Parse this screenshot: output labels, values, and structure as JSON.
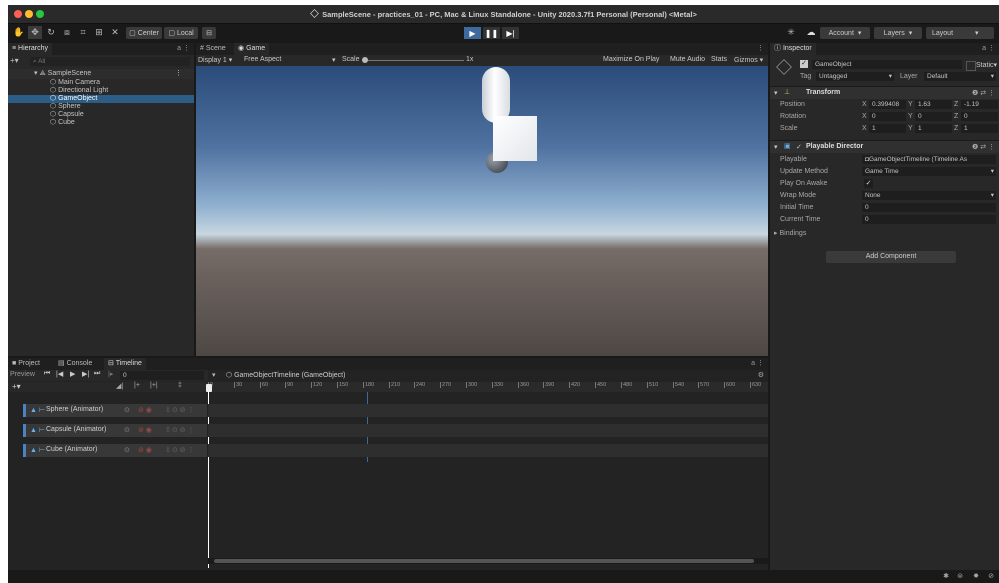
{
  "window": {
    "title": "SampleScene - practices_01 - PC, Mac & Linux Standalone - Unity 2020.3.7f1 Personal (Personal) <Metal>"
  },
  "toolbar": {
    "center_label": "Center",
    "local_label": "Local",
    "account_label": "Account",
    "layers_label": "Layers",
    "layout_label": "Layout"
  },
  "hierarchy": {
    "tab_label": "Hierarchy",
    "search_placeholder": "All",
    "scene": "SampleScene",
    "items": [
      {
        "label": "Main Camera",
        "selected": false
      },
      {
        "label": "Directional Light",
        "selected": false
      },
      {
        "label": "GameObject",
        "selected": true
      },
      {
        "label": "Sphere",
        "selected": false
      },
      {
        "label": "Capsule",
        "selected": false
      },
      {
        "label": "Cube",
        "selected": false
      }
    ]
  },
  "center": {
    "tabs": [
      {
        "label": "Scene"
      },
      {
        "label": "Game"
      }
    ],
    "display": "Display 1",
    "aspect": "Free Aspect",
    "scale_label": "Scale",
    "scale_value": "1x",
    "maximize": "Maximize On Play",
    "mute": "Mute Audio",
    "stats": "Stats",
    "gizmos": "Gizmos"
  },
  "inspector": {
    "tab_label": "Inspector",
    "object_name": "GameObject",
    "static_label": "Static",
    "tag_label": "Tag",
    "tag_value": "Untagged",
    "layer_label": "Layer",
    "layer_value": "Default",
    "transform": {
      "title": "Transform",
      "position_label": "Position",
      "position": {
        "x": "0.399408",
        "y": "1.63",
        "z": "-1.19"
      },
      "rotation_label": "Rotation",
      "rotation": {
        "x": "0",
        "y": "0",
        "z": "0"
      },
      "scale_label": "Scale",
      "scale": {
        "x": "1",
        "y": "1",
        "z": "1"
      }
    },
    "director": {
      "title": "Playable Director",
      "playable_label": "Playable",
      "playable_value": "GameObjectTimeline (Timeline As",
      "update_label": "Update Method",
      "update_value": "Game Time",
      "awake_label": "Play On Awake",
      "wrap_label": "Wrap Mode",
      "wrap_value": "None",
      "initial_label": "Initial Time",
      "initial_value": "0",
      "current_label": "Current Time",
      "current_value": "0",
      "bindings_label": "Bindings"
    },
    "add_component": "Add Component"
  },
  "bottom": {
    "tabs": [
      {
        "label": "Project"
      },
      {
        "label": "Console"
      },
      {
        "label": "Timeline"
      }
    ],
    "preview_label": "Preview",
    "frame_value": "0",
    "timeline_name": "GameObjectTimeline (GameObject)",
    "ticks": [
      "0",
      "30",
      "60",
      "90",
      "120",
      "150",
      "180",
      "210",
      "240",
      "270",
      "300",
      "330",
      "360",
      "390",
      "420",
      "450",
      "480",
      "510",
      "540",
      "570",
      "600",
      "630"
    ],
    "tracks": [
      {
        "label": "Sphere (Animator)"
      },
      {
        "label": "Capsule (Animator)"
      },
      {
        "label": "Cube (Animator)"
      }
    ]
  },
  "colors": {
    "accent": "#3e6a9e",
    "selected": "#2c5d87",
    "panel": "#282828",
    "sky_top": "#2b4c7a"
  }
}
